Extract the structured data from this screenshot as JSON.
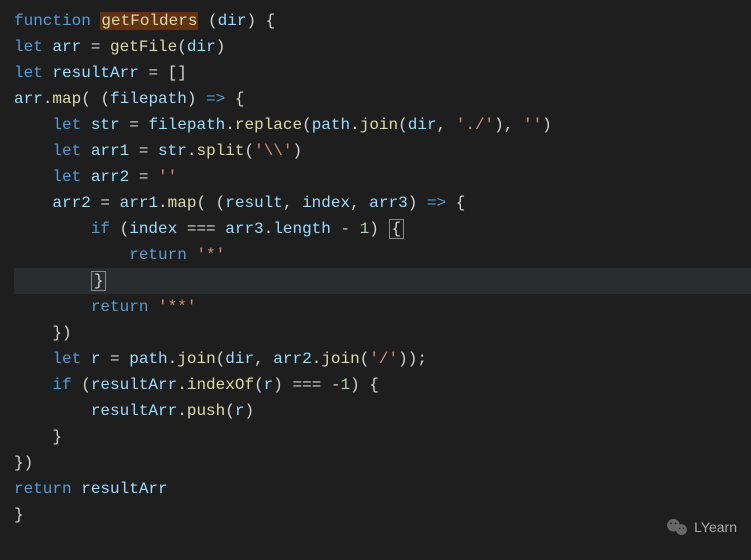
{
  "code": {
    "l1": {
      "t1": "function",
      "t2": "getFolders",
      "t3": " (",
      "t4": "dir",
      "t5": ") {"
    },
    "l2": {
      "t1": "let",
      "t2": "arr",
      "t3": " = ",
      "t4": "getFile",
      "t5": "(",
      "t6": "dir",
      "t7": ")"
    },
    "l3": {
      "t1": "let",
      "t2": "resultArr",
      "t3": " = []"
    },
    "l4": {
      "t1": "arr",
      "t2": ".",
      "t3": "map",
      "t4": "( (",
      "t5": "filepath",
      "t6": ") ",
      "t7": "=>",
      "t8": " {"
    },
    "l5": {
      "t1": "let",
      "t2": "str",
      "t3": " = ",
      "t4": "filepath",
      "t5": ".",
      "t6": "replace",
      "t7": "(",
      "t8": "path",
      "t9": ".",
      "t10": "join",
      "t11": "(",
      "t12": "dir",
      "t13": ", ",
      "t14": "'./'",
      "t15": "), ",
      "t16": "''",
      "t17": ")"
    },
    "l6": {
      "t1": "let",
      "t2": "arr1",
      "t3": " = ",
      "t4": "str",
      "t5": ".",
      "t6": "split",
      "t7": "(",
      "t8": "'\\\\'",
      "t9": ")"
    },
    "l7": {
      "t1": "let",
      "t2": "arr2",
      "t3": " = ",
      "t4": "''"
    },
    "l8": {
      "t1": "arr2",
      "t2": " = ",
      "t3": "arr1",
      "t4": ".",
      "t5": "map",
      "t6": "( (",
      "t7": "result",
      "t8": ", ",
      "t9": "index",
      "t10": ", ",
      "t11": "arr3",
      "t12": ") ",
      "t13": "=>",
      "t14": " {"
    },
    "l9": {
      "t1": "if",
      "t2": " (",
      "t3": "index",
      "t4": " === ",
      "t5": "arr3",
      "t6": ".",
      "t7": "length",
      "t8": " - ",
      "t9": "1",
      "t10": ") ",
      "t11": "{"
    },
    "l10": {
      "t1": "return",
      "t2": "'*'"
    },
    "l11": {
      "t1": "}"
    },
    "l12": {
      "t1": "return",
      "t2": "'**'"
    },
    "l13": {
      "t1": "})"
    },
    "l14": {
      "t1": "let",
      "t2": "r",
      "t3": " = ",
      "t4": "path",
      "t5": ".",
      "t6": "join",
      "t7": "(",
      "t8": "dir",
      "t9": ", ",
      "t10": "arr2",
      "t11": ".",
      "t12": "join",
      "t13": "(",
      "t14": "'/'",
      "t15": "));"
    },
    "l15": {
      "t1": "if",
      "t2": " (",
      "t3": "resultArr",
      "t4": ".",
      "t5": "indexOf",
      "t6": "(",
      "t7": "r",
      "t8": ") === ",
      "t9": "-",
      "t10": "1",
      "t11": ") {"
    },
    "l16": {
      "t1": "resultArr",
      "t2": ".",
      "t3": "push",
      "t4": "(",
      "t5": "r",
      "t6": ")"
    },
    "l17": {
      "t1": "}"
    },
    "l18": {
      "t1": "})"
    },
    "l19": {
      "t1": "return",
      "t2": "resultArr"
    },
    "l20": {
      "t1": "}"
    }
  },
  "watermark": {
    "text": "LYearn"
  }
}
